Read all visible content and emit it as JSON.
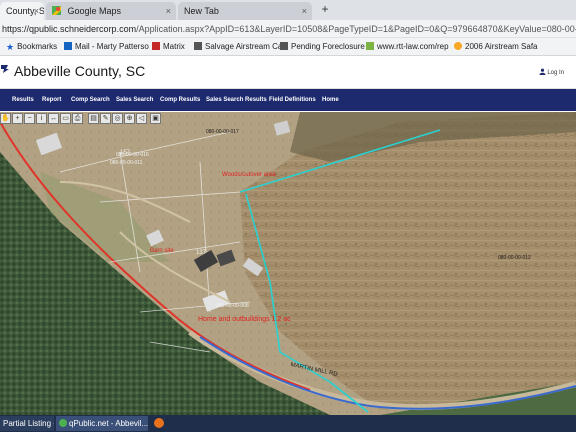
{
  "tabs": [
    {
      "label": "County, SC",
      "close": "×"
    },
    {
      "label": "Google Maps",
      "close": "×"
    },
    {
      "label": "New Tab",
      "close": "×"
    }
  ],
  "new_tab": "+",
  "address": {
    "host": "https://qpublic.schneidercorp.com",
    "path": "/Application.aspx?AppID=613&LayerID=10508&PageTypeID=1&PageID=0&Q=979664870&KeyValue=080-00-00-008"
  },
  "bookmarks": [
    {
      "label": "Bookmarks"
    },
    {
      "label": "Mail - Marty Patterso"
    },
    {
      "label": "Matrix"
    },
    {
      "label": "Salvage Airstream Ca"
    },
    {
      "label": "Pending Foreclosure"
    },
    {
      "label": "www.rtt-law.com/rep"
    },
    {
      "label": "2006 Airstream Safa"
    }
  ],
  "site": {
    "title": "Abbeville County, SC",
    "login": "Log In"
  },
  "nav": [
    "Results",
    "Report",
    "Comp Search",
    "Sales Search",
    "Comp Results",
    "Sales Search Results",
    "Field Definitions",
    "Home"
  ],
  "map": {
    "parcels": [
      {
        "label": "080-00-00-017"
      },
      {
        "label": "080-00-00-012"
      },
      {
        "label": "080-00-00-011"
      },
      {
        "label": "080-00-00-008"
      },
      {
        "label": "080-00-00-016"
      },
      {
        "label": "137"
      },
      {
        "label": "157"
      }
    ],
    "road": "MARTIN MILL RD",
    "annotations": [
      {
        "text": "Home and outbuildings 1.2 ac"
      },
      {
        "text": "Barn site"
      },
      {
        "text": "Woods/cutover area"
      }
    ]
  },
  "toolbar_tools": [
    "pan",
    "zoom-in",
    "zoom-out",
    "identify",
    "measure",
    "select",
    "print",
    "layers",
    "draw",
    "buffer",
    "full-extent",
    "prev",
    "next",
    "clear"
  ],
  "taskbar": [
    {
      "label": "Partial Listing -..."
    },
    {
      "label": "qPublic.net - Abbevil..."
    }
  ],
  "colors": {
    "nav": "#1d2a6e",
    "parcel_line": "#2ad1d1",
    "road_line": "#e0332a",
    "annotation": "#e02020"
  }
}
